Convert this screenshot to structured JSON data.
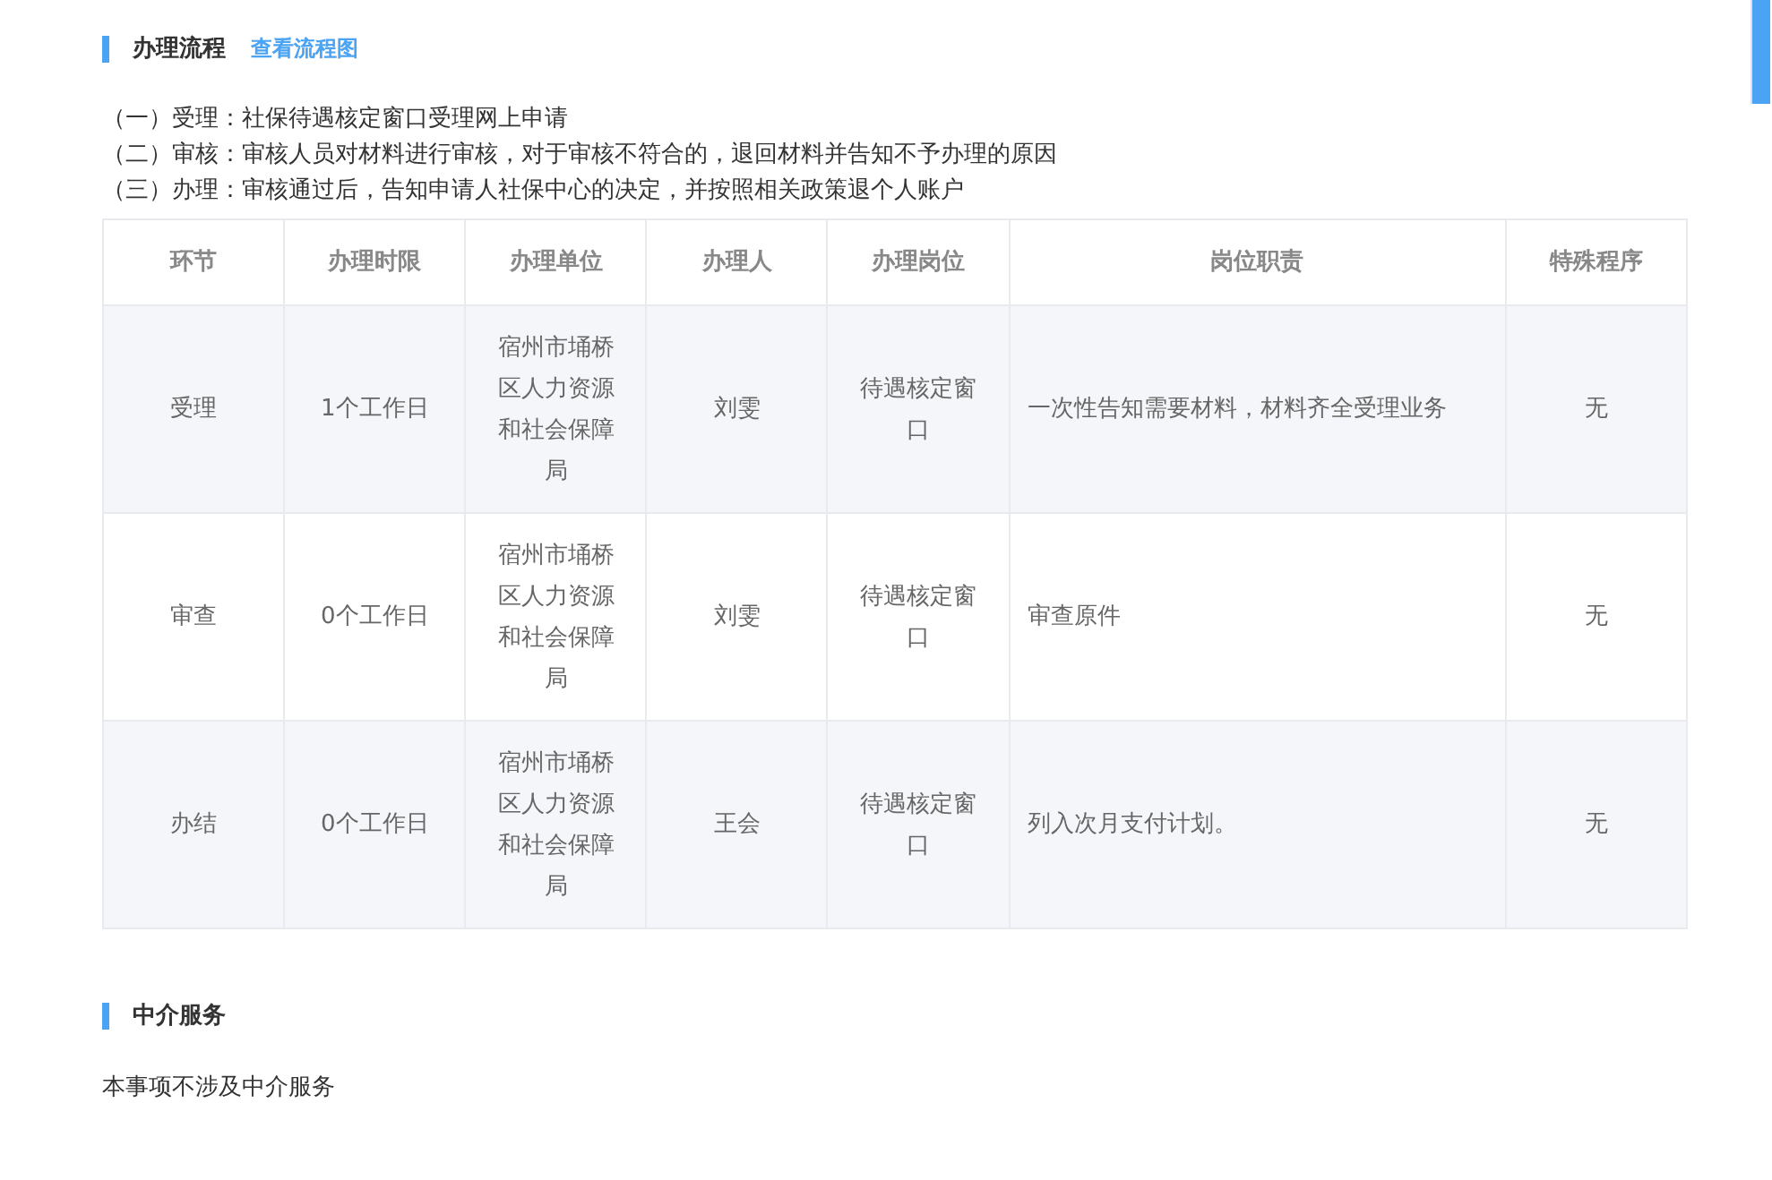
{
  "process_section": {
    "title": "办理流程",
    "link": "查看流程图",
    "steps": [
      "（一）受理：社保待遇核定窗口受理网上申请",
      "（二）审核：审核人员对材料进行审核，对于审核不符合的，退回材料并告知不予办理的原因",
      "（三）办理：审核通过后，告知申请人社保中心的决定，并按照相关政策退个人账户"
    ],
    "table": {
      "columns": [
        "环节",
        "办理时限",
        "办理单位",
        "办理人",
        "办理岗位",
        "岗位职责",
        "特殊程序"
      ],
      "rows": [
        [
          "受理",
          "1个工作日",
          "宿州市埇桥区人力资源和社会保障局",
          "刘雯",
          "待遇核定窗口",
          "一次性告知需要材料，材料齐全受理业务",
          "无"
        ],
        [
          "审查",
          "0个工作日",
          "宿州市埇桥区人力资源和社会保障局",
          "刘雯",
          "待遇核定窗口",
          "审查原件",
          "无"
        ],
        [
          "办结",
          "0个工作日",
          "宿州市埇桥区人力资源和社会保障局",
          "王会",
          "待遇核定窗口",
          "列入次月支付计划。",
          "无"
        ]
      ]
    }
  },
  "agency_section": {
    "title": "中介服务",
    "text": "本事项不涉及中介服务"
  }
}
